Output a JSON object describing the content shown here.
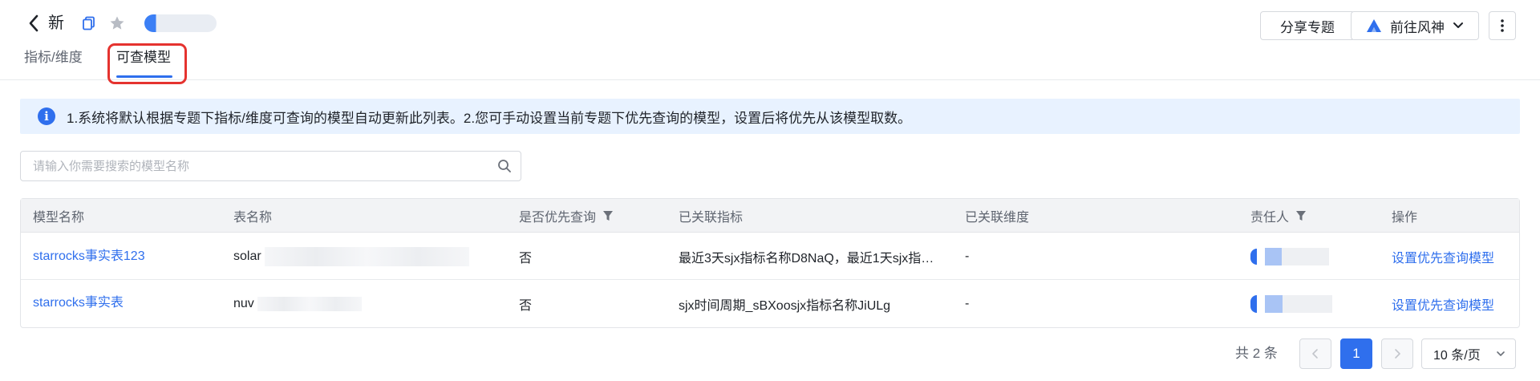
{
  "header": {
    "title": "新",
    "share_label": "分享专题",
    "goto_label": "前往风神"
  },
  "tabs": [
    {
      "label": "指标/维度",
      "active": false
    },
    {
      "label": "可查模型",
      "active": true
    }
  ],
  "banner": {
    "text": "1.系统将默认根据专题下指标/维度可查询的模型自动更新此列表。2.您可手动设置当前专题下优先查询的模型，设置后将优先从该模型取数。"
  },
  "search": {
    "placeholder": "请输入你需要搜索的模型名称",
    "value": ""
  },
  "table": {
    "columns": [
      "模型名称",
      "表名称",
      "是否优先查询",
      "已关联指标",
      "已关联维度",
      "责任人",
      "操作"
    ],
    "rows": [
      {
        "model_name": "starrocks事实表123",
        "table_name": "solar",
        "priority": "否",
        "metrics": "最近3天sjx指标名称D8NaQ，最近1天sjx指…",
        "dimensions": "-",
        "action": "设置优先查询模型"
      },
      {
        "model_name": "starrocks事实表",
        "table_name": "nuv",
        "priority": "否",
        "metrics": "sjx时间周期_sBXoosjx指标名称JiULg",
        "dimensions": "-",
        "action": "设置优先查询模型"
      }
    ]
  },
  "pagination": {
    "total_text": "共 2 条",
    "current_page": "1",
    "page_size": "10 条/页"
  },
  "colors": {
    "primary": "#2f6fed",
    "highlight_box": "#e5332f",
    "banner_bg": "#e8f2ff"
  }
}
